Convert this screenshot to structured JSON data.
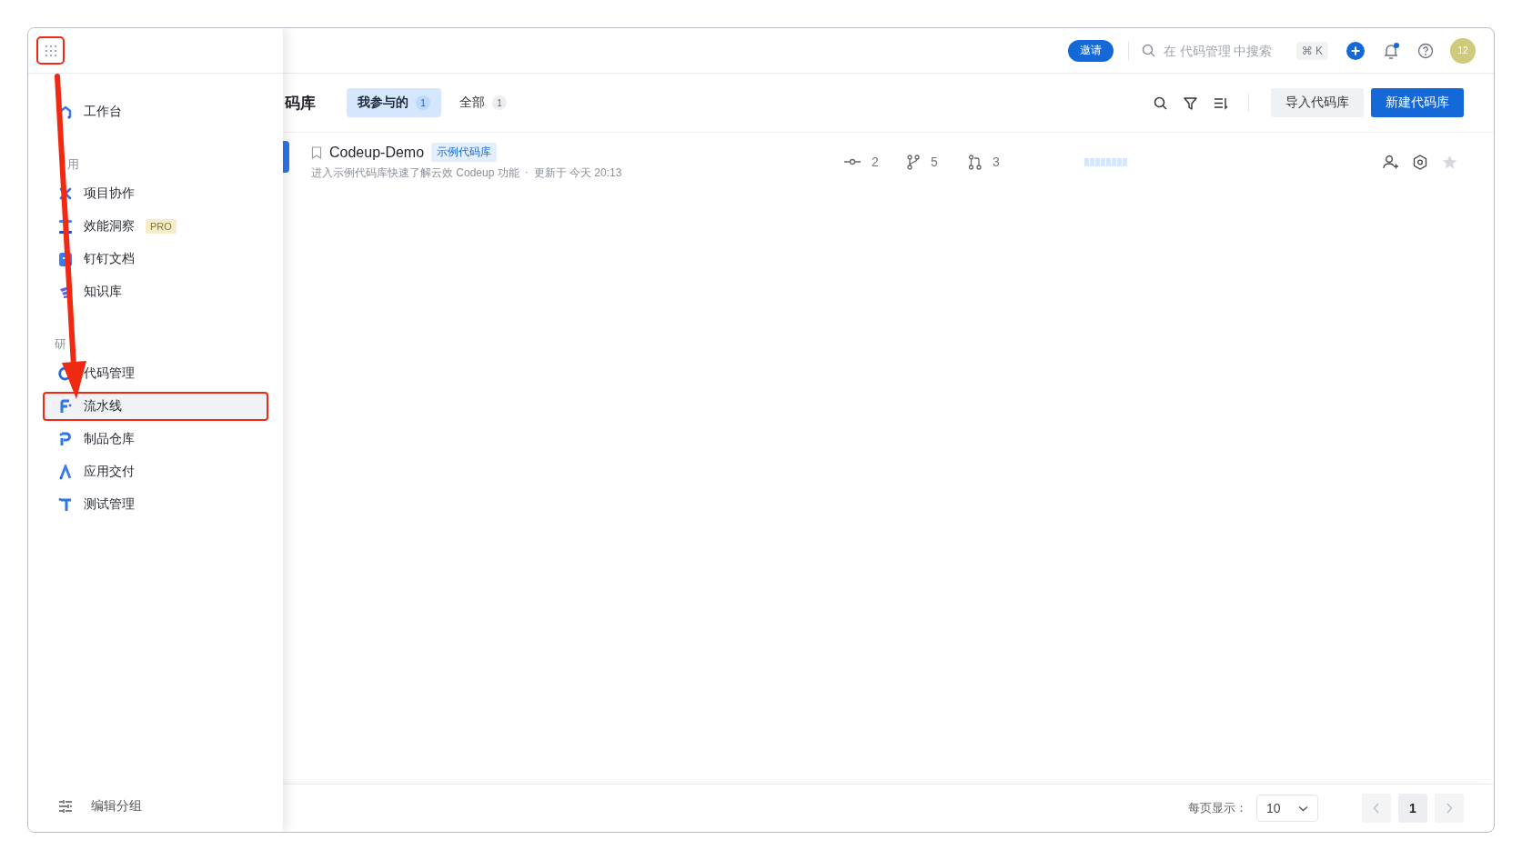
{
  "drawer": {
    "launcher": {
      "highlighted": true
    },
    "top_items": [
      {
        "label": "工作台",
        "kind": "workbench",
        "selected": false,
        "highlighted": false
      }
    ],
    "sections": [
      {
        "title": "用",
        "items": [
          {
            "label": "项目协作",
            "kind": "project",
            "selected": false,
            "highlighted": false
          },
          {
            "label": "效能洞察",
            "kind": "insight",
            "selected": false,
            "highlighted": false,
            "badge": "PRO"
          },
          {
            "label": "钉钉文档",
            "kind": "docs",
            "selected": false,
            "highlighted": false
          },
          {
            "label": "知识库",
            "kind": "knowledge",
            "selected": false,
            "highlighted": false
          }
        ]
      },
      {
        "title": "研",
        "items": [
          {
            "label": "代码管理",
            "kind": "code",
            "selected": false,
            "highlighted": false
          },
          {
            "label": "流水线",
            "kind": "pipeline",
            "selected": true,
            "highlighted": true
          },
          {
            "label": "制品仓库",
            "kind": "packages",
            "selected": false,
            "highlighted": false
          },
          {
            "label": "应用交付",
            "kind": "delivery",
            "selected": false,
            "highlighted": false
          },
          {
            "label": "测试管理",
            "kind": "testing",
            "selected": false,
            "highlighted": false
          }
        ]
      }
    ],
    "footer": "编辑分组",
    "annotation_arrow": true
  },
  "top_bar": {
    "invite": "邀请",
    "search_placeholder": "在 代码管理 中搜索",
    "shortcut": "⌘ K",
    "notifications_unread": true,
    "avatar": "12"
  },
  "header": {
    "title": "码库",
    "tabs": [
      {
        "label": "我参与的",
        "count": "1",
        "selected": true
      },
      {
        "label": "全部",
        "count": "1",
        "selected": false
      }
    ],
    "buttons": [
      {
        "label": "导入代码库",
        "kind": "secondary"
      },
      {
        "label": "新建代码库",
        "kind": "primary"
      }
    ]
  },
  "repos": [
    {
      "name": "Codeup-Demo",
      "tag": "示例代码库",
      "description": "进入示例代码库快速了解云效 Codeup 功能",
      "separator": "·",
      "updated": "更新于 今天 20:13",
      "stats": [
        {
          "kind": "commits",
          "value": "2"
        },
        {
          "kind": "branches",
          "value": "5"
        },
        {
          "kind": "merge_requests",
          "value": "3"
        }
      ],
      "starred": false
    }
  ],
  "footer": {
    "page_size_label": "每页显示：",
    "page_size": "10",
    "prev_disabled": true,
    "next_disabled": true,
    "pages": [
      {
        "label": "1",
        "selected": true
      }
    ]
  }
}
